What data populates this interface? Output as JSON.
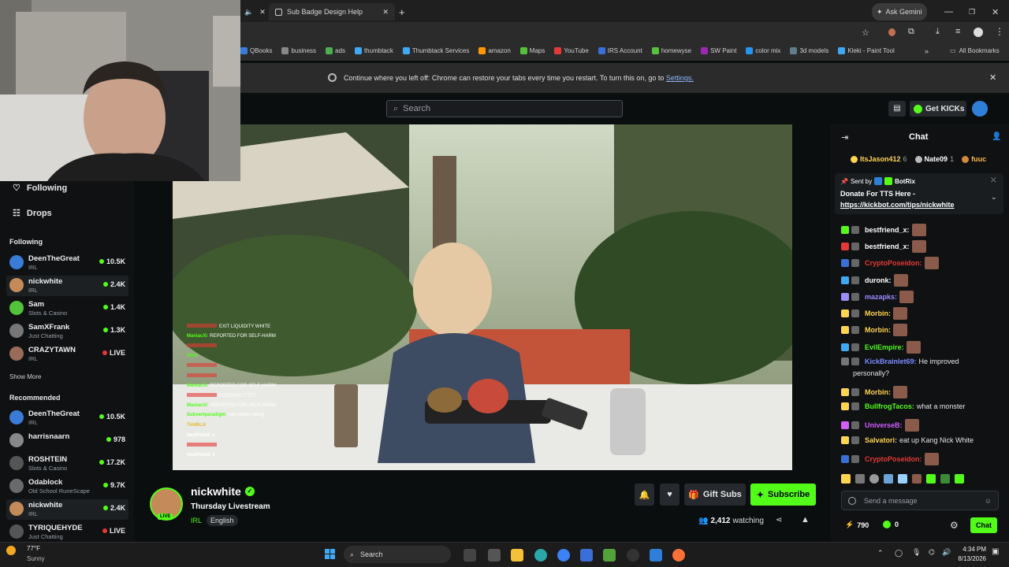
{
  "browser": {
    "tabs": [
      {
        "title": "Sub Badge Design Help"
      }
    ],
    "ask_gemini": "Ask Gemini",
    "bookmarks": [
      "QBooks",
      "business",
      "ads",
      "thumbtack",
      "Thumbtack Services",
      "amazon",
      "Maps",
      "YouTube",
      "IRS Account",
      "homewyse",
      "SW Paint",
      "color mix",
      "3d models",
      "Kleki - Paint Tool"
    ],
    "all_bookmarks": "All Bookmarks",
    "restore_text": "Continue where you left off: Chrome can restore your tabs every time you restart. To turn this on, go to",
    "restore_link": "Settings."
  },
  "header": {
    "search_placeholder": "Search",
    "get_kicks": "Get KICKs"
  },
  "sidebar": {
    "nav": [
      {
        "label": "Following"
      },
      {
        "label": "Drops"
      }
    ],
    "following_title": "Following",
    "following": [
      {
        "name": "DeenTheGreat",
        "category": "IRL",
        "viewers": "10.5K",
        "live": false,
        "color": "#3a7bd5"
      },
      {
        "name": "nickwhite",
        "category": "IRL",
        "viewers": "2.4K",
        "live": false,
        "color": "#c48a5a"
      },
      {
        "name": "Sam",
        "category": "Slots & Casino",
        "viewers": "1.4K",
        "live": false,
        "color": "#53c23a"
      },
      {
        "name": "SamXFrank",
        "category": "Just Chatting",
        "viewers": "1.3K",
        "live": false,
        "color": "#777777"
      },
      {
        "name": "CRAZYTAWN",
        "category": "IRL",
        "viewers": "LIVE",
        "live": true,
        "color": "#9b6b5a"
      }
    ],
    "show_more": "Show More",
    "recommended_title": "Recommended",
    "recommended": [
      {
        "name": "DeenTheGreat",
        "category": "IRL",
        "viewers": "10.5K",
        "live": false,
        "color": "#3a7bd5"
      },
      {
        "name": "harrisnaarn",
        "category": "",
        "viewers": "978",
        "live": false,
        "color": "#888888"
      },
      {
        "name": "ROSHTEIN",
        "category": "Slots & Casino",
        "viewers": "17.2K",
        "live": false,
        "color": "#555555"
      },
      {
        "name": "Odablock",
        "category": "Old School RuneScape",
        "viewers": "9.7K",
        "live": false,
        "color": "#6a6a6a"
      },
      {
        "name": "nickwhite",
        "category": "IRL",
        "viewers": "2.4K",
        "live": false,
        "color": "#c48a5a"
      },
      {
        "name": "TYRIQUEHYDE",
        "category": "Just Chatting",
        "viewers": "LIVE",
        "live": true,
        "color": "#555555"
      }
    ]
  },
  "video_overlay_chat": [
    {
      "user": "",
      "text": "EXIT LIQUIDITY WHITE",
      "color": "#e53935"
    },
    {
      "user": "ManiacXi",
      "text": "REPORTED FOR SELF-HARM",
      "color": "#53fc18"
    },
    {
      "user": "",
      "text": "",
      "color": "#e53935"
    },
    {
      "user": "itVee",
      "text": "",
      "color": "#53fc18"
    },
    {
      "user": "",
      "text": "",
      "color": "#e53935"
    },
    {
      "user": "",
      "text": "",
      "color": "#e53935"
    },
    {
      "user": "ManiacXi",
      "text": "REPORTED FOR SELF-HARM",
      "color": "#53fc18"
    },
    {
      "user": "",
      "text": "FUCKKKK ITTTT",
      "color": "#e53935"
    },
    {
      "user": "ManiacXi",
      "text": "REPORTED FOR SELF-HARM",
      "color": "#53fc18"
    },
    {
      "user": "Subvertparadigm",
      "text": "nah keeep eating",
      "color": "#53fc18"
    },
    {
      "user": "TimMcJr",
      "text": "",
      "color": "#e5b935"
    },
    {
      "user": "bestfriend_x",
      "text": "",
      "color": "#ffffff"
    },
    {
      "user": "",
      "text": "",
      "color": "#e53935"
    },
    {
      "user": "bestfriend_x",
      "text": "",
      "color": "#ffffff"
    }
  ],
  "stream": {
    "channel": "nickwhite",
    "title": "Thursday Livestream",
    "category": "IRL",
    "language": "English",
    "live_label": "LIVE",
    "gift_subs": "Gift Subs",
    "subscribe": "Subscribe",
    "watching": "2,412",
    "watching_label": "watching"
  },
  "chat": {
    "title": "Chat",
    "top_gifters": [
      {
        "name": "ItsJason412",
        "count": "6"
      },
      {
        "name": "Nate09",
        "count": "1"
      },
      {
        "name": "fuuc",
        "count": ""
      }
    ],
    "pinned_sent_by": "Sent by",
    "pinned_bot": "BotRix",
    "pinned_text": "Donate For TTS Here -",
    "pinned_link": "https://kickbot.com/tips/nickwhite",
    "messages": [
      {
        "user": "bestfriend_x:",
        "text": "",
        "color": "#ffffff"
      },
      {
        "user": "bestfriend_x:",
        "text": "",
        "color": "#ffffff"
      },
      {
        "user": "CryptoPoseidon:",
        "text": "",
        "color": "#e53935"
      },
      {
        "user": "duronk:",
        "text": "",
        "color": "#ffffff"
      },
      {
        "user": "mazapks:",
        "text": "",
        "color": "#9b8cff"
      },
      {
        "user": "Morbin:",
        "text": "",
        "color": "#ffd54f"
      },
      {
        "user": "Morbin:",
        "text": "",
        "color": "#ffd54f"
      },
      {
        "user": "EvilEmpire:",
        "text": "",
        "color": "#53fc18"
      },
      {
        "user": "KickBrainlet69:",
        "text": "He improved",
        "color": "#7c8cff"
      },
      {
        "user": "",
        "text": "personally?",
        "color": "#ffffff"
      },
      {
        "user": "Morbin:",
        "text": "",
        "color": "#ffd54f"
      },
      {
        "user": "BullfrogTacos:",
        "text": "what a monster",
        "color": "#53fc18"
      },
      {
        "user": "UniverseB:",
        "text": "",
        "color": "#d35cff"
      },
      {
        "user": "Salvatori:",
        "text": "eat up Kang Nick White",
        "color": "#ffd54f"
      },
      {
        "user": "CryptoPoseidon:",
        "text": "",
        "color": "#e53935"
      }
    ],
    "input_placeholder": "Send a message",
    "points": "790",
    "kicks": "0",
    "chat_button": "Chat"
  },
  "taskbar": {
    "weather_temp": "77°F",
    "weather_desc": "Sunny",
    "search": "Search",
    "time": "4:34 PM",
    "date": "8/13/2026"
  }
}
